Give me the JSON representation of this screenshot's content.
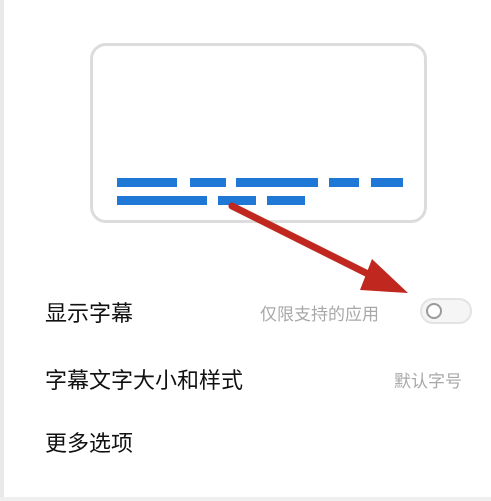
{
  "preview": {
    "icon": "caption-preview-illustration",
    "accent_color": "#1f77d6",
    "arrow_color": "#c0271f"
  },
  "settings": {
    "show_captions": {
      "label": "显示字幕",
      "hint": "仅限支持的应用",
      "toggle_on": false
    },
    "caption_style": {
      "label": "字幕文字大小和样式",
      "value": "默认字号"
    },
    "more_options": {
      "label": "更多选项"
    }
  }
}
